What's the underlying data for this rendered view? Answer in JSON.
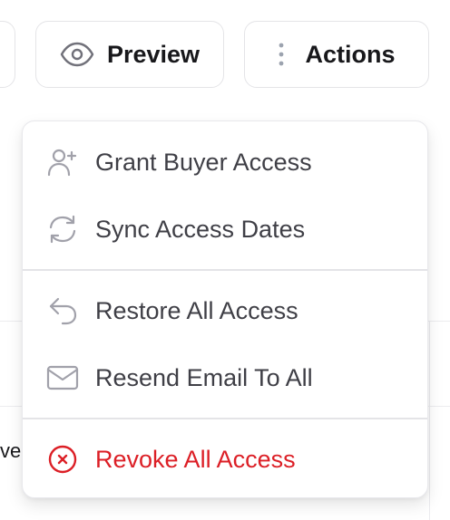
{
  "header": {
    "preview_label": "Preview",
    "actions_label": "Actions"
  },
  "background": {
    "cut_text": "ve"
  },
  "menu": {
    "items": [
      {
        "label": "Grant Buyer Access",
        "icon": "user-plus-icon"
      },
      {
        "label": "Sync Access Dates",
        "icon": "refresh-icon"
      },
      {
        "label": "Restore All Access",
        "icon": "undo-icon"
      },
      {
        "label": "Resend Email To All",
        "icon": "mail-icon"
      },
      {
        "label": "Revoke All Access",
        "icon": "x-circle-icon",
        "danger": true
      }
    ]
  },
  "colors": {
    "icon_gray": "#a1a1aa",
    "text": "#3f3f46",
    "danger": "#dc1f26",
    "border": "#e4e4e7"
  }
}
